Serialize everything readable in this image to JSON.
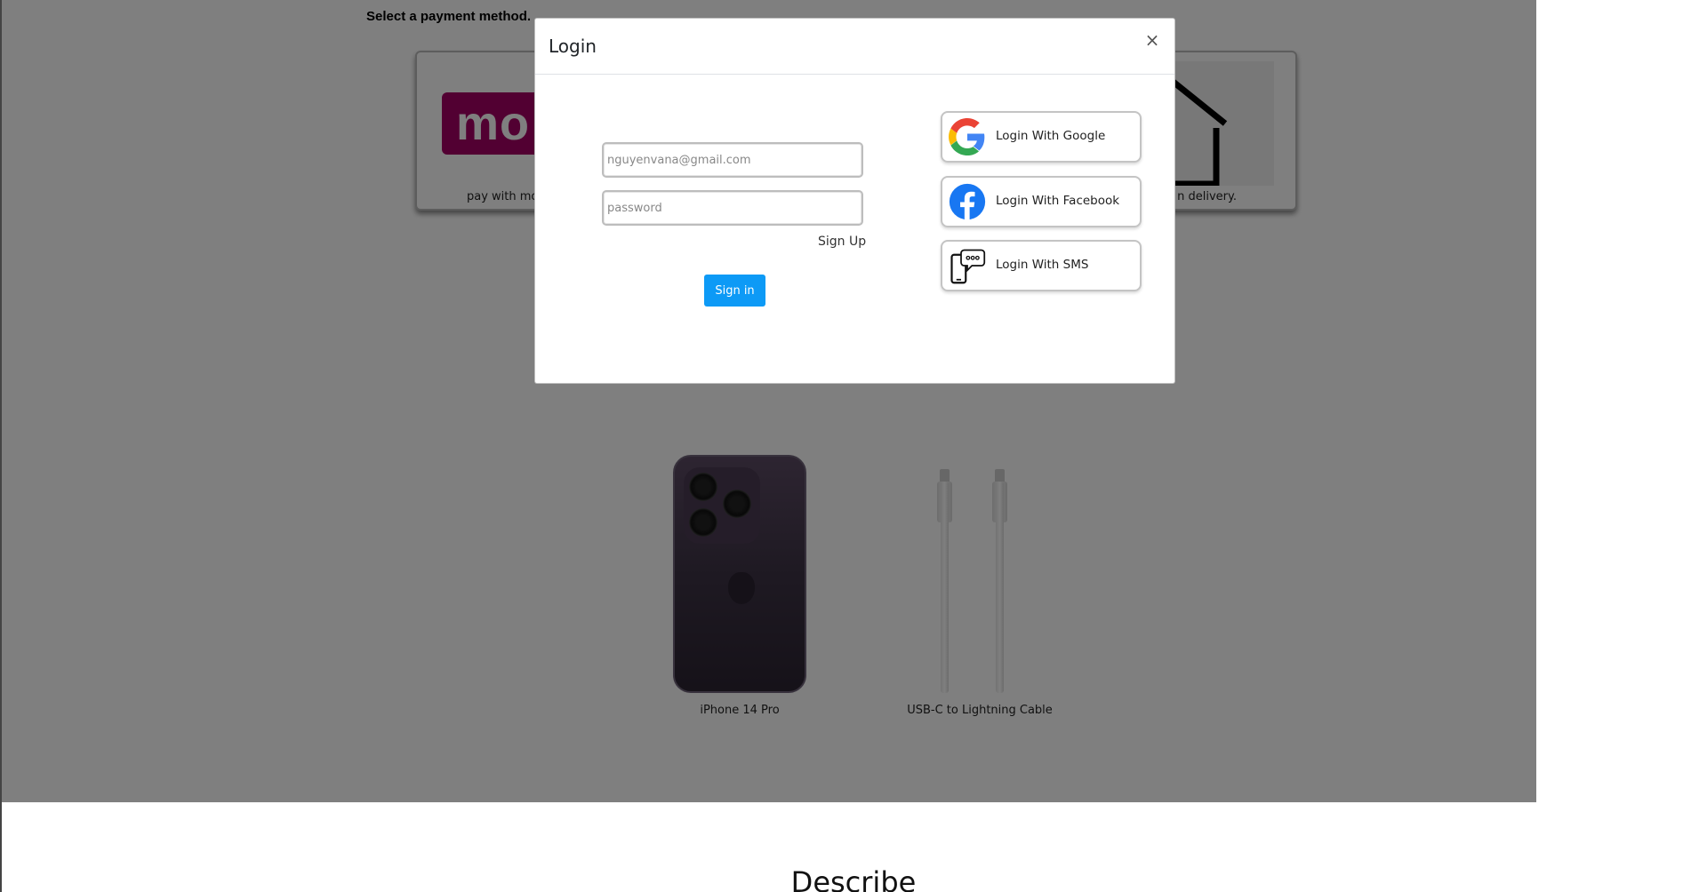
{
  "payment": {
    "title": "Select a payment method.",
    "momo_logo_text": "mo",
    "momo_label": "pay with mo",
    "cod_label": "n delivery."
  },
  "products": [
    {
      "name": "iPhone 14 Pro"
    },
    {
      "name": "USB-C to Lightning Cable"
    }
  ],
  "describe_heading": "Describe",
  "modal": {
    "title": "Login",
    "close_label": "×",
    "email_placeholder": "nguyenvana@gmail.com",
    "password_placeholder": "password",
    "signup_label": "Sign Up",
    "signin_label": "Sign in",
    "social": {
      "google": "Login With Google",
      "facebook": "Login With Facebook",
      "sms": "Login With SMS"
    }
  },
  "colors": {
    "overlay": "rgba(0,0,0,0.5)",
    "primary_button": "#0d9af6",
    "momo_brand": "#a50064",
    "facebook_blue": "#1877f2"
  }
}
